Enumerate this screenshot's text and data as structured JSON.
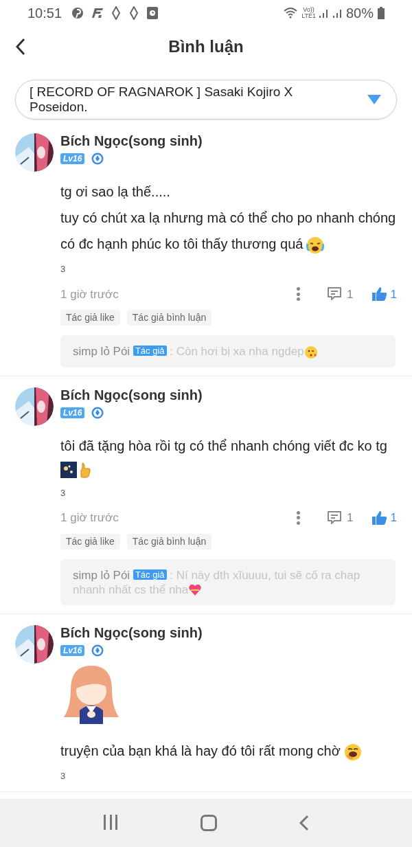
{
  "status_bar": {
    "time": "10:51",
    "network": "Vo))",
    "network_sub": "LTE1",
    "battery": "80%"
  },
  "header": {
    "title": "Bình luận"
  },
  "story_select": {
    "value": "[ RECORD OF RAGNAROK ] Sasaki Kojiro X Poseidon."
  },
  "comments": [
    {
      "author": "Bích Ngọc(song sinh)",
      "level": "Lv16",
      "lines": [
        {
          "text": "tg ơi sao lạ thế....."
        },
        {
          "text": "tuy có chút xa lạ nhưng mà có thể cho po nhanh chóng có đc hạnh phúc ko tôi thấy thương quá",
          "emojis": [
            {
              "kind": "crying"
            }
          ]
        }
      ],
      "count": "3",
      "time": "1 giờ trước",
      "replies": "1",
      "likes": "1",
      "liked": true,
      "tags": [
        "Tác giả like",
        "Tác giả bình luận"
      ],
      "reply": {
        "author": "simp lỏ Pói",
        "badge": "Tác giả",
        "text": ": Còn hơi bị xa nha ngdep",
        "emojis": [
          {
            "kind": "kiss"
          }
        ]
      }
    },
    {
      "author": "Bích Ngọc(song sinh)",
      "level": "Lv16",
      "lines": [
        {
          "text": "tôi đã tặng hòa rồi tg có thể nhanh chóng viết đc ko tg"
        },
        {
          "emojis": [
            {
              "kind": "fireworks"
            },
            {
              "kind": "thumbs"
            }
          ]
        }
      ],
      "count": "3",
      "time": "1 giờ trước",
      "replies": "1",
      "likes": "1",
      "liked": true,
      "tags": [
        "Tác giả like",
        "Tác giả bình luận"
      ],
      "reply": {
        "author": "simp lỏ Pói",
        "badge": "Tác giả",
        "text": ": Ní này dth xĩuuuu, tui sẽ cố ra chap nhanh nhất cs thể nha",
        "emojis": [
          {
            "kind": "heart"
          }
        ]
      }
    },
    {
      "author": "Bích Ngọc(song sinh)",
      "level": "Lv16",
      "sticker": {
        "kind": "picture"
      },
      "lines": [
        {
          "text": "truyện của bạn khá là hay đó tôi rất mong chờ",
          "emojis": [
            {
              "kind": "yawn"
            }
          ]
        }
      ],
      "count": "3"
    }
  ]
}
